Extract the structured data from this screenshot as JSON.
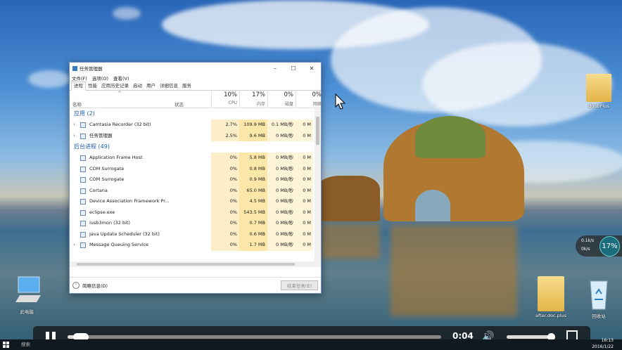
{
  "window": {
    "title": "任务管理器",
    "menu": [
      "文件(F)",
      "选项(O)",
      "查看(V)"
    ],
    "tabs": [
      "进程",
      "性能",
      "应用历史记录",
      "启动",
      "用户",
      "详细信息",
      "服务"
    ],
    "active_tab": "进程"
  },
  "columns": {
    "name": "名称",
    "status": "状态",
    "cpu": {
      "pct": "10%",
      "label": "CPU"
    },
    "mem": {
      "pct": "17%",
      "label": "内存"
    },
    "disk": {
      "pct": "0%",
      "label": "磁盘"
    },
    "net": {
      "pct": "0%",
      "label": "网络"
    }
  },
  "groups": {
    "apps": {
      "label": "应用 (2)"
    },
    "background": {
      "label": "后台进程 (49)"
    }
  },
  "apps_rows": [
    {
      "name": "Camtasia Recorder (32 bit)",
      "cpu": "2.7%",
      "mem": "109.9 MB",
      "disk": "0.1 MB/秒",
      "net": "0 M"
    },
    {
      "name": "任务管理器",
      "cpu": "2.5%",
      "mem": "9.6 MB",
      "disk": "0 MB/秒",
      "net": "0 M"
    }
  ],
  "bg_rows": [
    {
      "name": "Application Frame Host",
      "cpu": "0%",
      "mem": "5.8 MB",
      "disk": "0 MB/秒",
      "net": "0 M"
    },
    {
      "name": "COM Surrogate",
      "cpu": "0%",
      "mem": "0.8 MB",
      "disk": "0 MB/秒",
      "net": "0 M"
    },
    {
      "name": "COM Surrogate",
      "cpu": "0%",
      "mem": "0.9 MB",
      "disk": "0 MB/秒",
      "net": "0 M"
    },
    {
      "name": "Cortana",
      "cpu": "0%",
      "mem": "65.0 MB",
      "disk": "0 MB/秒",
      "net": "0 M"
    },
    {
      "name": "Device Association Framework Pr...",
      "cpu": "0%",
      "mem": "4.5 MB",
      "disk": "0 MB/秒",
      "net": "0 M"
    },
    {
      "name": "eclipse.exe",
      "cpu": "0%",
      "mem": "543.5 MB",
      "disk": "0 MB/秒",
      "net": "0 M"
    },
    {
      "name": "iusb3mon (32 bit)",
      "cpu": "0%",
      "mem": "0.7 MB",
      "disk": "0 MB/秒",
      "net": "0 M"
    },
    {
      "name": "Java Update Scheduler (32 bit)",
      "cpu": "0%",
      "mem": "0.6 MB",
      "disk": "0 MB/秒",
      "net": "0 M"
    },
    {
      "name": "Message Queuing Service",
      "cpu": "0%",
      "mem": "1.7 MB",
      "disk": "0 MB/秒",
      "net": "0 M"
    }
  ],
  "footer": {
    "less_details": "简略信息(D)",
    "end_task": "结束任务(E)"
  },
  "desktop": {
    "icon_topright": "doubPlus",
    "icon_computer": "此电脑",
    "icon_folder2": "after.doc.plus",
    "icon_recycle": "回收站"
  },
  "net_widget": {
    "up": "0.1k/s",
    "down": "0k/s",
    "pct": "17%"
  },
  "player": {
    "time": "0:04",
    "progress": 0.03,
    "volume": 0.88
  },
  "taskbar": {
    "search": "搜索",
    "time": "16:13",
    "date": "2016/1/22"
  }
}
